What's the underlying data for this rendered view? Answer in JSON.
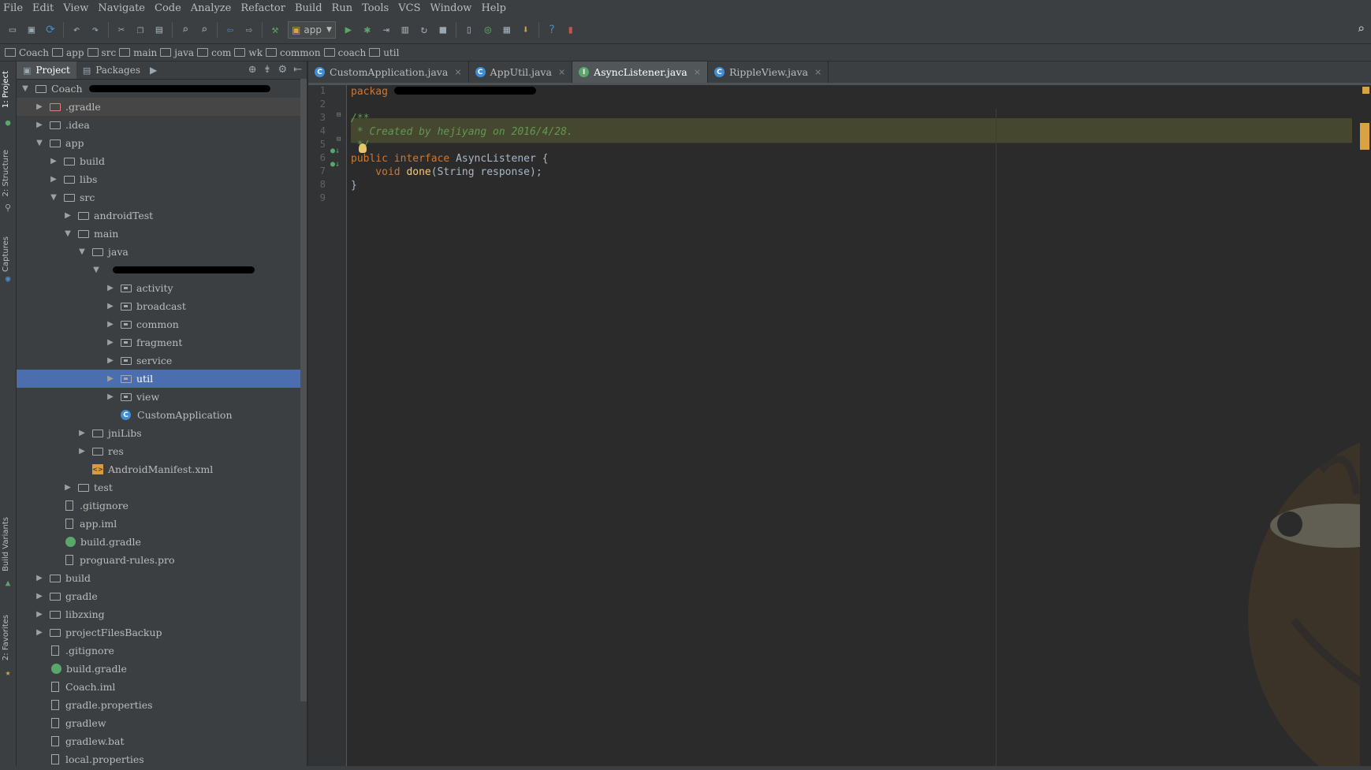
{
  "menu": [
    "File",
    "Edit",
    "View",
    "Navigate",
    "Code",
    "Analyze",
    "Refactor",
    "Build",
    "Run",
    "Tools",
    "VCS",
    "Window",
    "Help"
  ],
  "toolbar": {
    "run_config": "app"
  },
  "breadcrumb": [
    "Coach",
    "app",
    "src",
    "main",
    "java",
    "com",
    "wk",
    "common",
    "coach",
    "util"
  ],
  "side_tools": [
    "1: Project",
    "2: Structure",
    "Captures",
    "Build Variants",
    "2: Favorites"
  ],
  "project_panel": {
    "tabs": [
      "Project",
      "Packages"
    ],
    "tree": [
      {
        "label": "Coach",
        "depth": 0,
        "arrow": "down",
        "icon": "folder",
        "name": "tree-root-coach"
      },
      {
        "label": ".gradle",
        "depth": 1,
        "arrow": "right",
        "icon": "folder-pink",
        "name": "tree-gradle-dir"
      },
      {
        "label": ".idea",
        "depth": 1,
        "arrow": "right",
        "icon": "folder",
        "name": "tree-idea"
      },
      {
        "label": "app",
        "depth": 1,
        "arrow": "down",
        "icon": "folder",
        "name": "tree-app"
      },
      {
        "label": "build",
        "depth": 2,
        "arrow": "right",
        "icon": "folder",
        "name": "tree-app-build"
      },
      {
        "label": "libs",
        "depth": 2,
        "arrow": "right",
        "icon": "folder",
        "name": "tree-libs"
      },
      {
        "label": "src",
        "depth": 2,
        "arrow": "down",
        "icon": "folder",
        "name": "tree-src"
      },
      {
        "label": "androidTest",
        "depth": 3,
        "arrow": "right",
        "icon": "folder",
        "name": "tree-androidtest"
      },
      {
        "label": "main",
        "depth": 3,
        "arrow": "down",
        "icon": "folder",
        "name": "tree-main"
      },
      {
        "label": "java",
        "depth": 4,
        "arrow": "down",
        "icon": "folder",
        "name": "tree-java"
      },
      {
        "label": "",
        "depth": 5,
        "arrow": "down",
        "icon": "redacted",
        "name": "tree-package-redacted"
      },
      {
        "label": "activity",
        "depth": 6,
        "arrow": "right",
        "icon": "package",
        "name": "tree-activity"
      },
      {
        "label": "broadcast",
        "depth": 6,
        "arrow": "right",
        "icon": "package",
        "name": "tree-broadcast"
      },
      {
        "label": "common",
        "depth": 6,
        "arrow": "right",
        "icon": "package",
        "name": "tree-common"
      },
      {
        "label": "fragment",
        "depth": 6,
        "arrow": "right",
        "icon": "package",
        "name": "tree-fragment"
      },
      {
        "label": "service",
        "depth": 6,
        "arrow": "right",
        "icon": "package",
        "name": "tree-service"
      },
      {
        "label": "util",
        "depth": 6,
        "arrow": "right",
        "icon": "package",
        "name": "tree-util"
      },
      {
        "label": "view",
        "depth": 6,
        "arrow": "right",
        "icon": "package",
        "name": "tree-view"
      },
      {
        "label": "CustomApplication",
        "depth": 6,
        "arrow": "none",
        "icon": "class",
        "name": "tree-customapplication"
      },
      {
        "label": "jniLibs",
        "depth": 4,
        "arrow": "right",
        "icon": "folder",
        "name": "tree-jnilibs"
      },
      {
        "label": "res",
        "depth": 4,
        "arrow": "right",
        "icon": "folder",
        "name": "tree-res"
      },
      {
        "label": "AndroidManifest.xml",
        "depth": 4,
        "arrow": "none",
        "icon": "xml",
        "name": "tree-manifest"
      },
      {
        "label": "test",
        "depth": 3,
        "arrow": "right",
        "icon": "folder",
        "name": "tree-test"
      },
      {
        "label": ".gitignore",
        "depth": 2,
        "arrow": "none",
        "icon": "file",
        "name": "tree-app-gitignore"
      },
      {
        "label": "app.iml",
        "depth": 2,
        "arrow": "none",
        "icon": "file",
        "name": "tree-app-iml"
      },
      {
        "label": "build.gradle",
        "depth": 2,
        "arrow": "none",
        "icon": "gradle",
        "name": "tree-app-buildgradle"
      },
      {
        "label": "proguard-rules.pro",
        "depth": 2,
        "arrow": "none",
        "icon": "file",
        "name": "tree-proguard"
      },
      {
        "label": "build",
        "depth": 1,
        "arrow": "right",
        "icon": "folder",
        "name": "tree-build"
      },
      {
        "label": "gradle",
        "depth": 1,
        "arrow": "right",
        "icon": "folder",
        "name": "tree-gradle"
      },
      {
        "label": "libzxing",
        "depth": 1,
        "arrow": "right",
        "icon": "folder",
        "name": "tree-libzxing"
      },
      {
        "label": "projectFilesBackup",
        "depth": 1,
        "arrow": "right",
        "icon": "folder",
        "name": "tree-projectfilesbackup"
      },
      {
        "label": ".gitignore",
        "depth": 1,
        "arrow": "none",
        "icon": "file",
        "name": "tree-gitignore"
      },
      {
        "label": "build.gradle",
        "depth": 1,
        "arrow": "none",
        "icon": "gradle",
        "name": "tree-buildgradle"
      },
      {
        "label": "Coach.iml",
        "depth": 1,
        "arrow": "none",
        "icon": "file",
        "name": "tree-coach-iml"
      },
      {
        "label": "gradle.properties",
        "depth": 1,
        "arrow": "none",
        "icon": "file",
        "name": "tree-gradle-properties"
      },
      {
        "label": "gradlew",
        "depth": 1,
        "arrow": "none",
        "icon": "file",
        "name": "tree-gradlew"
      },
      {
        "label": "gradlew.bat",
        "depth": 1,
        "arrow": "none",
        "icon": "file",
        "name": "tree-gradlew-bat"
      },
      {
        "label": "local.properties",
        "depth": 1,
        "arrow": "none",
        "icon": "file",
        "name": "tree-local-properties"
      }
    ]
  },
  "editor": {
    "tabs": [
      {
        "label": "CustomApplication.java",
        "kind": "class"
      },
      {
        "label": "AppUtil.java",
        "kind": "class"
      },
      {
        "label": "AsyncListener.java",
        "kind": "interface"
      },
      {
        "label": "RippleView.java",
        "kind": "class"
      }
    ],
    "line_numbers": [
      "1",
      "2",
      "3",
      "4",
      "5",
      "6",
      "7",
      "8",
      "9"
    ],
    "code": {
      "l1": "packag",
      "l3": "/**",
      "l4": " * Created by hejiyang on 2016/4/28.",
      "l5": " */",
      "l6_kw": "public interface ",
      "l6_name": "AsyncListener",
      "l6_rest": " {",
      "l7_kw": "    void ",
      "l7_fn": "done",
      "l7_rest": "(String response);",
      "l8": "}"
    }
  },
  "colors": {
    "selection": "#4b6eaf",
    "keyword": "#cc7832",
    "comment": "#629755",
    "function": "#ffc66d"
  }
}
